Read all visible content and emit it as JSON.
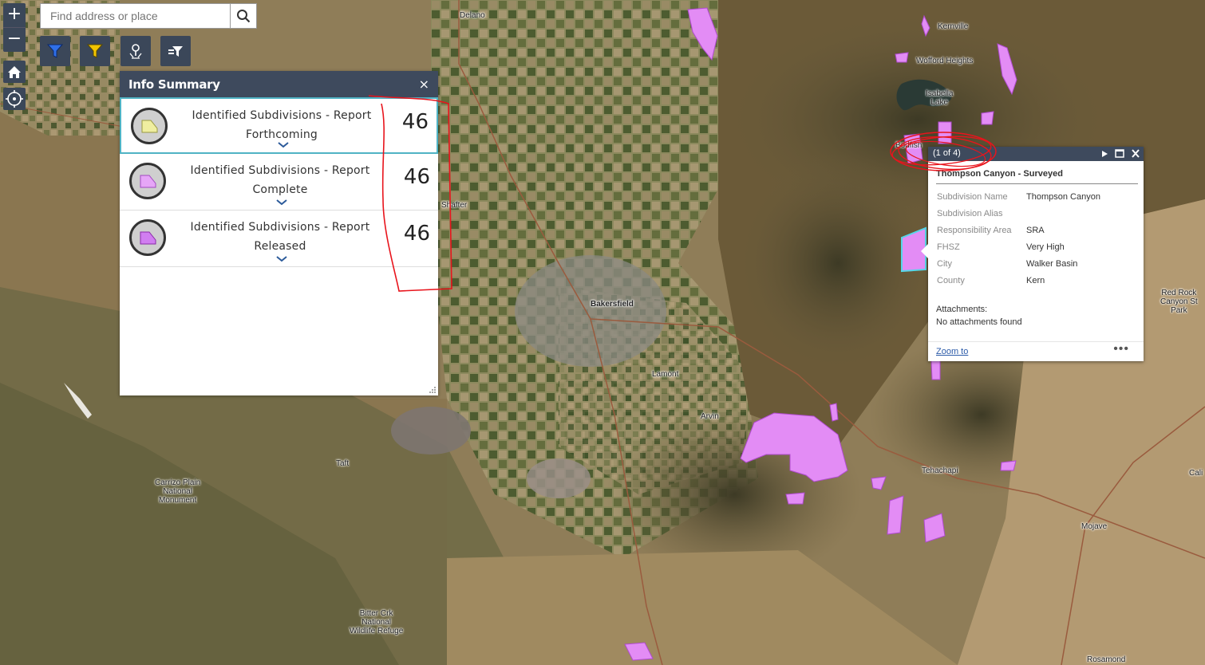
{
  "search": {
    "placeholder": "Find address or place"
  },
  "icons": {
    "zoom_in": "+",
    "zoom_out": "−",
    "home": "home-icon",
    "locate": "locate-icon",
    "search": "search-icon",
    "filter_blue": "filter-icon",
    "filter_yellow": "filter-icon",
    "edit_point": "location-pin-icon",
    "layer_filter": "layers-filter-icon"
  },
  "colors": {
    "panel_header": "#3e4a5d",
    "active_row_border": "#4fb3c4",
    "polygon_fill": "#e38cf5",
    "annotation": "#e8141c"
  },
  "info_summary": {
    "title": "Info Summary",
    "close": "×",
    "rows": [
      {
        "label": "Identified Subdivisions - Report Forthcoming",
        "count": "46",
        "symbol": "#efeea0",
        "active": true
      },
      {
        "label": "Identified Subdivisions - Report Complete",
        "count": "46",
        "symbol": "#e6a6f7",
        "active": false
      },
      {
        "label": "Identified Subdivisions - Report Released",
        "count": "46",
        "symbol": "#d17ef1",
        "active": false
      }
    ]
  },
  "popup": {
    "counter": "(1 of 4)",
    "title": "Thompson Canyon - Surveyed",
    "attributes": [
      {
        "key": "Subdivision Name",
        "value": "Thompson Canyon"
      },
      {
        "key": "Subdivision Alias",
        "value": ""
      },
      {
        "key": "Responsibility Area",
        "value": "SRA"
      },
      {
        "key": "FHSZ",
        "value": "Very High"
      },
      {
        "key": "City",
        "value": "Walker Basin"
      },
      {
        "key": "County",
        "value": "Kern"
      }
    ],
    "attachments_label": "Attachments:",
    "attachments_value": "No attachments found",
    "zoom_to": "Zoom to",
    "more": "•••"
  },
  "map_labels": {
    "delano": "Delano",
    "kernville": "Kernville",
    "wofford": "Wofford Heights",
    "isabella_1": "Isabella",
    "isabella_2": "Lake",
    "bodfish": "Bodfish",
    "shafter": "Shafter",
    "bakersfield": "Bakersfield",
    "lamont": "Lamont",
    "arvin": "Arvin",
    "taft": "Taft",
    "tehachapi": "Tehachapi",
    "mojave": "Mojave",
    "rosamond": "Rosamond",
    "cali": "Cali",
    "carrizo_1": "Carrizo Plain",
    "carrizo_2": "National",
    "carrizo_3": "Monument",
    "bitter_1": "Bitter Crk",
    "bitter_2": "National",
    "bitter_3": "Wildlife Refuge",
    "redrock_1": "Red Rock",
    "redrock_2": "Canyon St",
    "redrock_3": "Park"
  }
}
